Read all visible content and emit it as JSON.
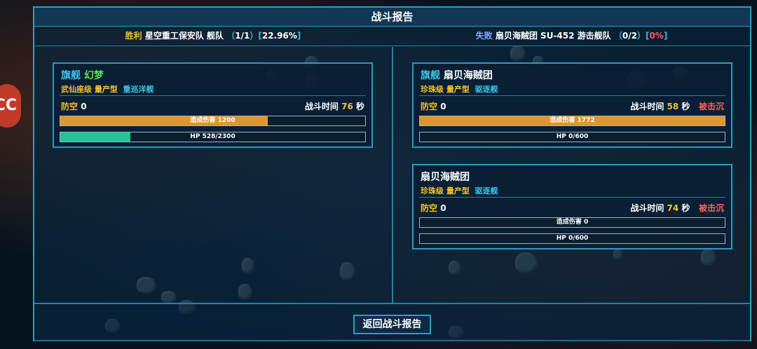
{
  "title": "战斗报告",
  "summary": {
    "left": {
      "result": "胜利",
      "fleet_name": "星空重工保安队 舰队",
      "count": "1/1",
      "percent": "22.96%"
    },
    "right": {
      "result": "失败",
      "fleet_name": "扇贝海贼团 SU-452 游击舰队",
      "count": "0/2",
      "percent": "0%"
    }
  },
  "labels": {
    "flagship": "旗舰",
    "anti_air": "防空",
    "battle_time": "战斗时间",
    "seconds": "秒",
    "damage": "造成伤害",
    "hp": "HP"
  },
  "ally_ships": [
    {
      "name": "幻梦",
      "class": "武仙座级",
      "type": "量产型",
      "role": "重巡洋舰",
      "anti_air": "0",
      "time": "76",
      "damage": "1200",
      "damage_frac": 0.68,
      "hp": "528/2300",
      "hp_frac": 0.23,
      "status": ""
    }
  ],
  "enemy_ships": [
    {
      "name": "扇贝海贼团",
      "class": "珍珠级",
      "type": "量产型",
      "role": "驱逐舰",
      "anti_air": "0",
      "time": "58",
      "damage": "1772",
      "damage_frac": 1.0,
      "hp": "0/600",
      "hp_frac": 0,
      "status": "被击沉"
    },
    {
      "name": "扇贝海贼团",
      "class": "珍珠级",
      "type": "量产型",
      "role": "驱逐舰",
      "anti_air": "0",
      "time": "74",
      "damage": "0",
      "damage_frac": 0,
      "hp": "0/600",
      "hp_frac": 0,
      "status": "被击沉"
    }
  ],
  "return_button": "返回战斗报告",
  "side_logo": "CC",
  "colors": {
    "accent": "#2aa0c4",
    "damage_fill": "#e0962a",
    "hp_fill": "#22c493",
    "win": "#f2c12b",
    "lose": "#8aa8ff",
    "sunk": "#ff6060"
  }
}
